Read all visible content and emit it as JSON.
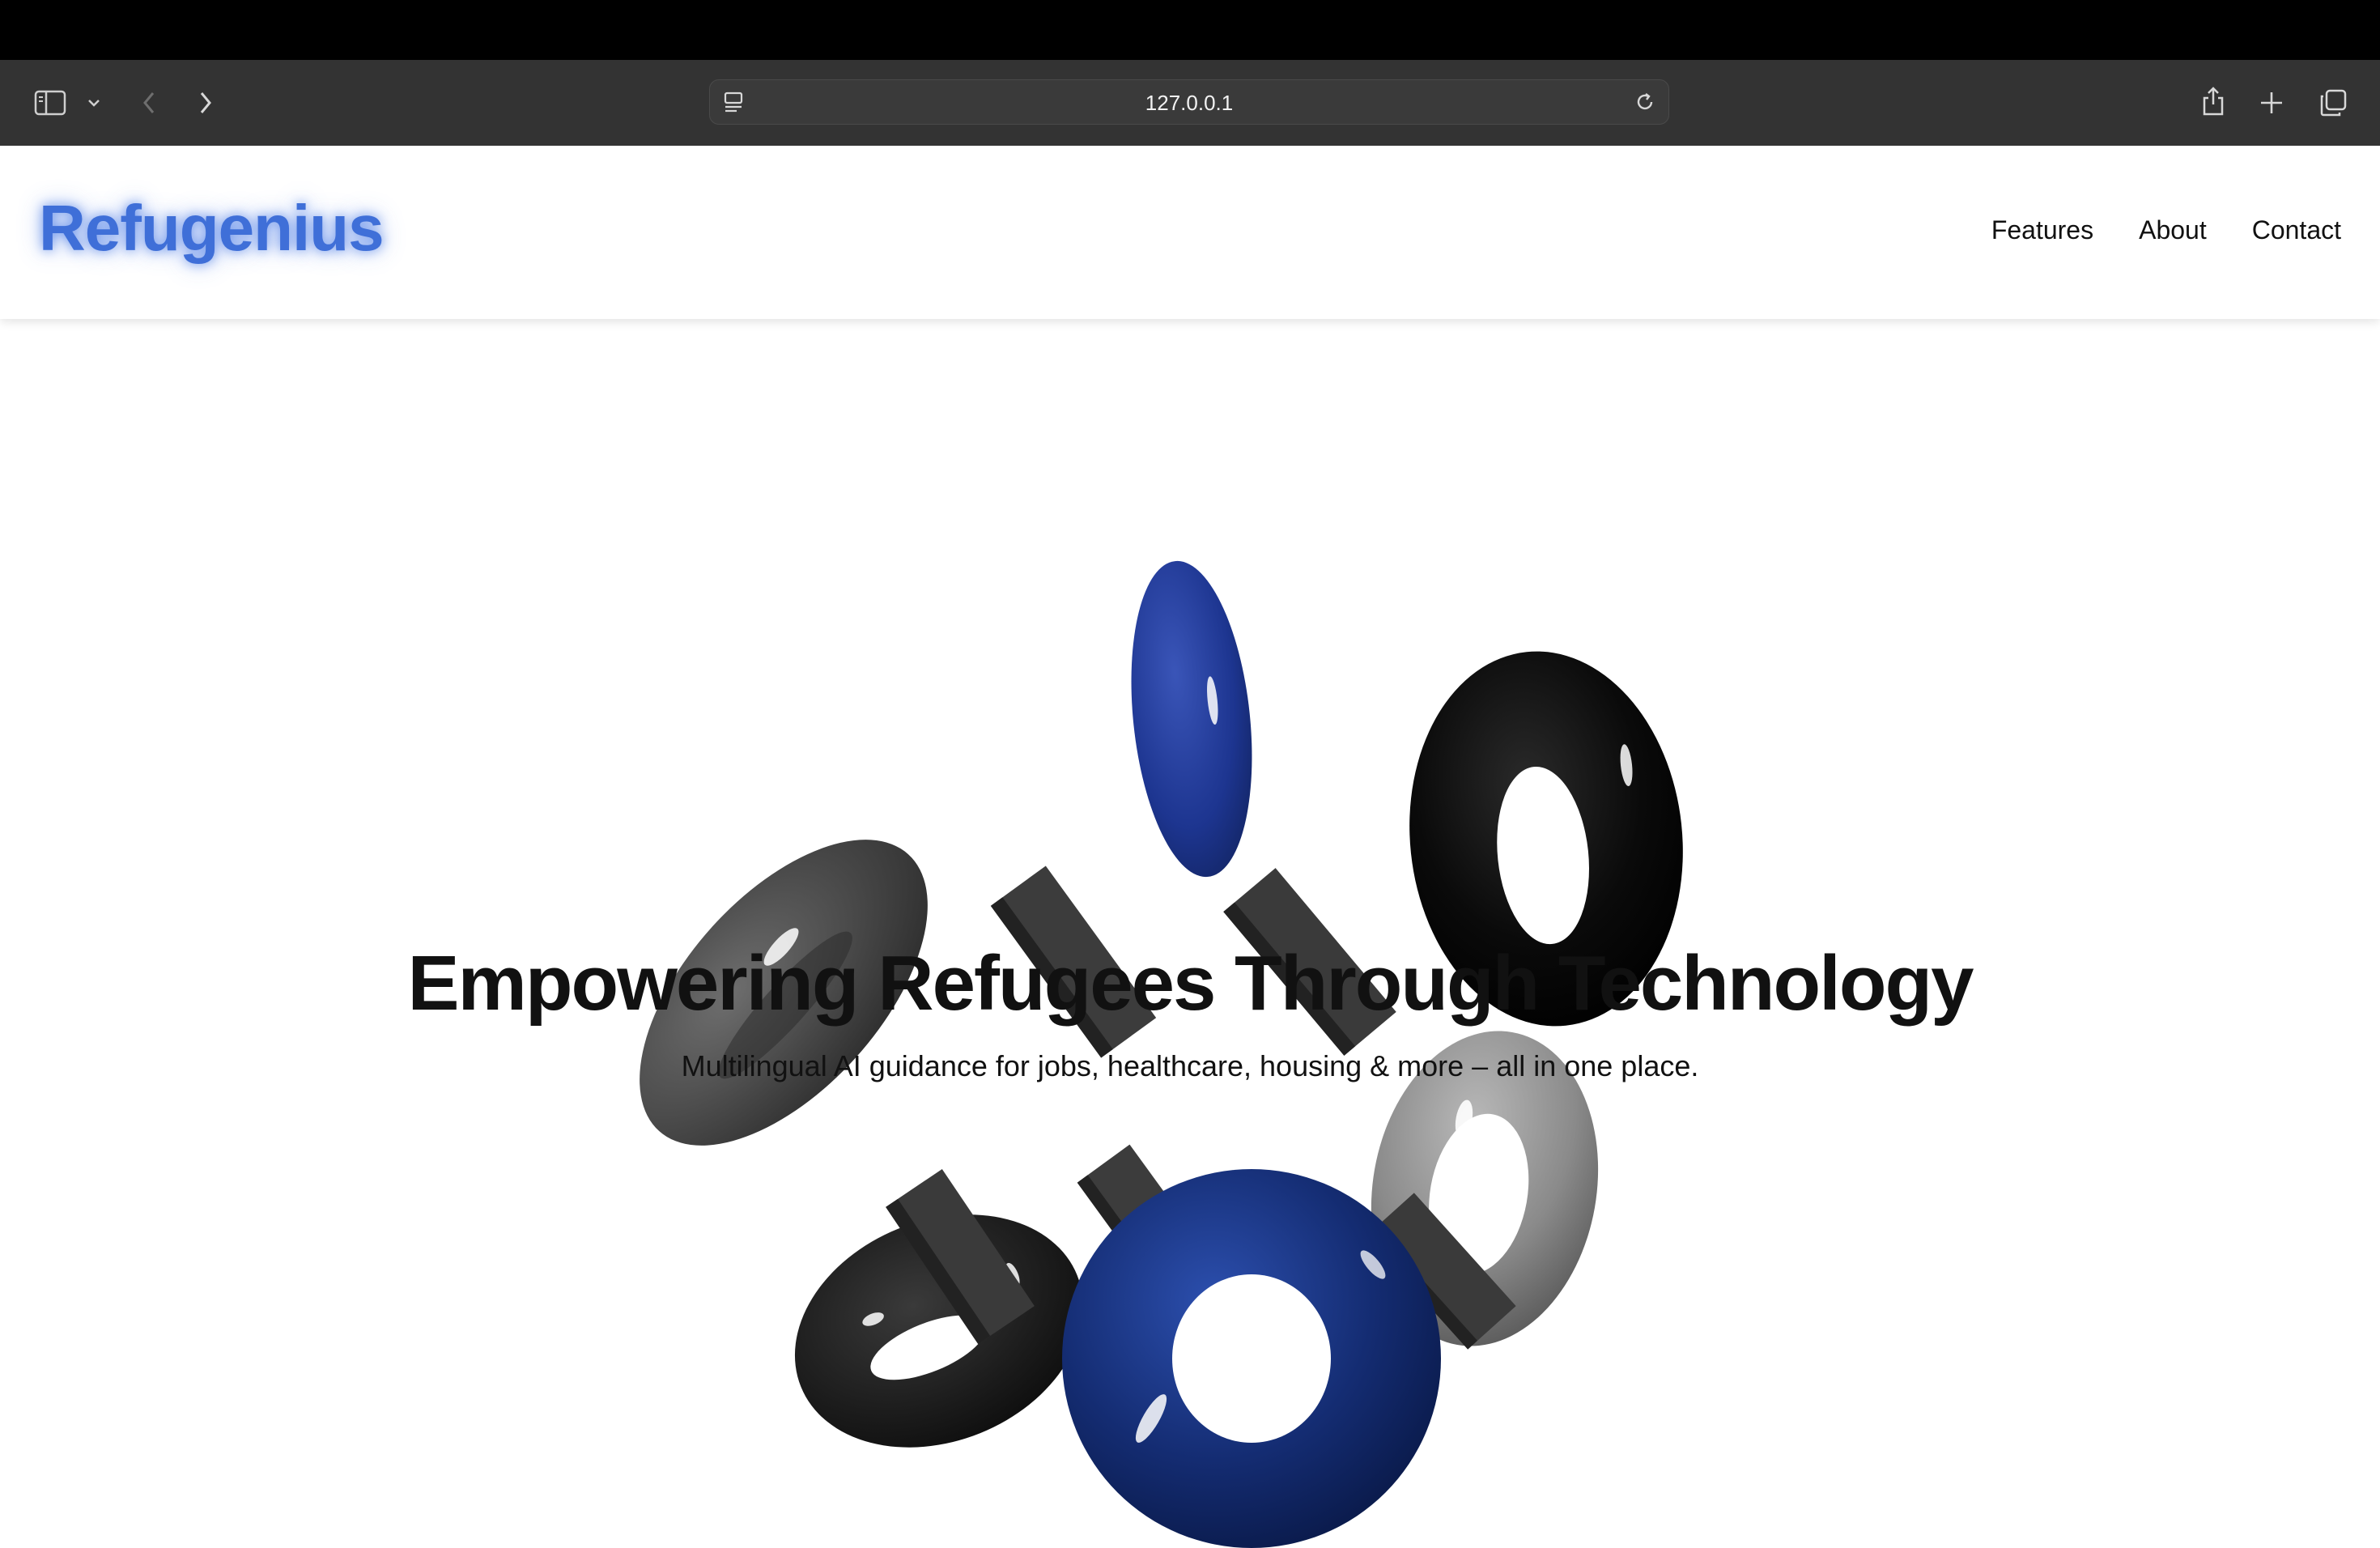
{
  "browser": {
    "url": "127.0.0.1",
    "icons": [
      "sidebar-icon",
      "chevron-down-icon",
      "back-arrow-icon",
      "forward-arrow-icon",
      "page-menu-icon",
      "reload-icon",
      "share-icon",
      "new-tab-icon",
      "tabs-overview-icon"
    ]
  },
  "site": {
    "logo": "Refugenius",
    "nav": [
      "Features",
      "About",
      "Contact"
    ]
  },
  "hero": {
    "title": "Empowering Refugees Through Technology",
    "subtitle": "Multilingual AI guidance for jobs, healthcare, housing & more – all in one place."
  },
  "colors": {
    "logo": "#3f6fd8",
    "toolbar": "#333333",
    "torus_blue": "#1e3a8a",
    "torus_black": "#0a0a0a",
    "torus_gray": "#4a4a4a"
  }
}
